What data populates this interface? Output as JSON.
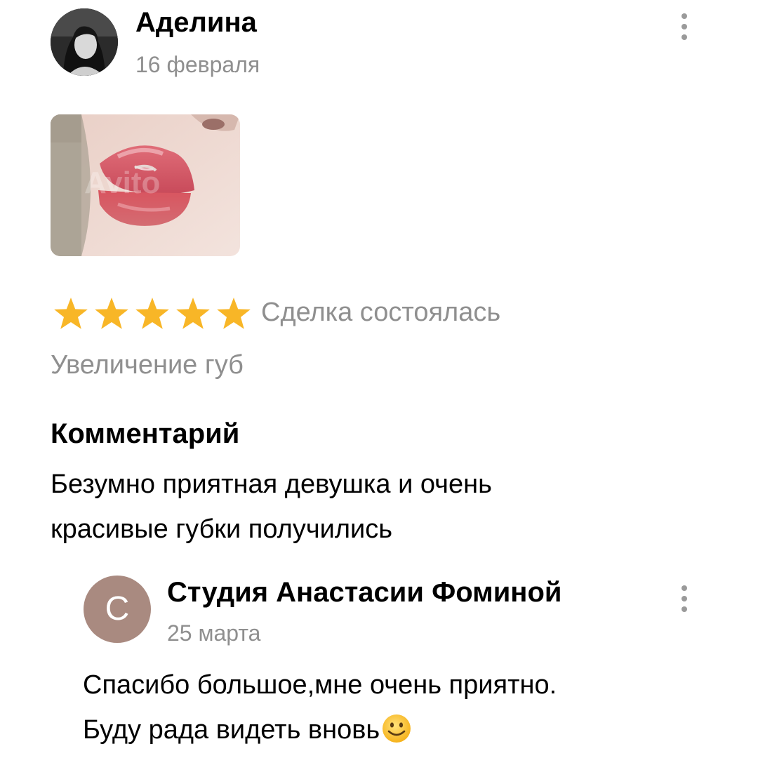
{
  "review": {
    "author": "Аделина",
    "date": "16 февраля",
    "avatar_icon": "user-photo",
    "menu_icon": "more-vertical-icon",
    "photo_watermark": "Avito",
    "rating": 5,
    "rating_max": 5,
    "star_color": "#F8B627",
    "deal_status": "Сделка состоялась",
    "service": "Увеличение губ",
    "comment_heading": "Комментарий",
    "comment_lines": [
      "Безумно приятная девушка и очень",
      "красивые губки получились"
    ]
  },
  "reply": {
    "avatar_letter": "С",
    "avatar_color": "#A98A80",
    "author": "Студия Анастасии Фоминой",
    "date": "25 марта",
    "menu_icon": "more-vertical-icon",
    "text_lines": [
      "Спасибо большое,мне очень приятно.",
      "Буду рада видеть вновь"
    ],
    "emoji_icon": "slightly-smiling-face-icon"
  }
}
